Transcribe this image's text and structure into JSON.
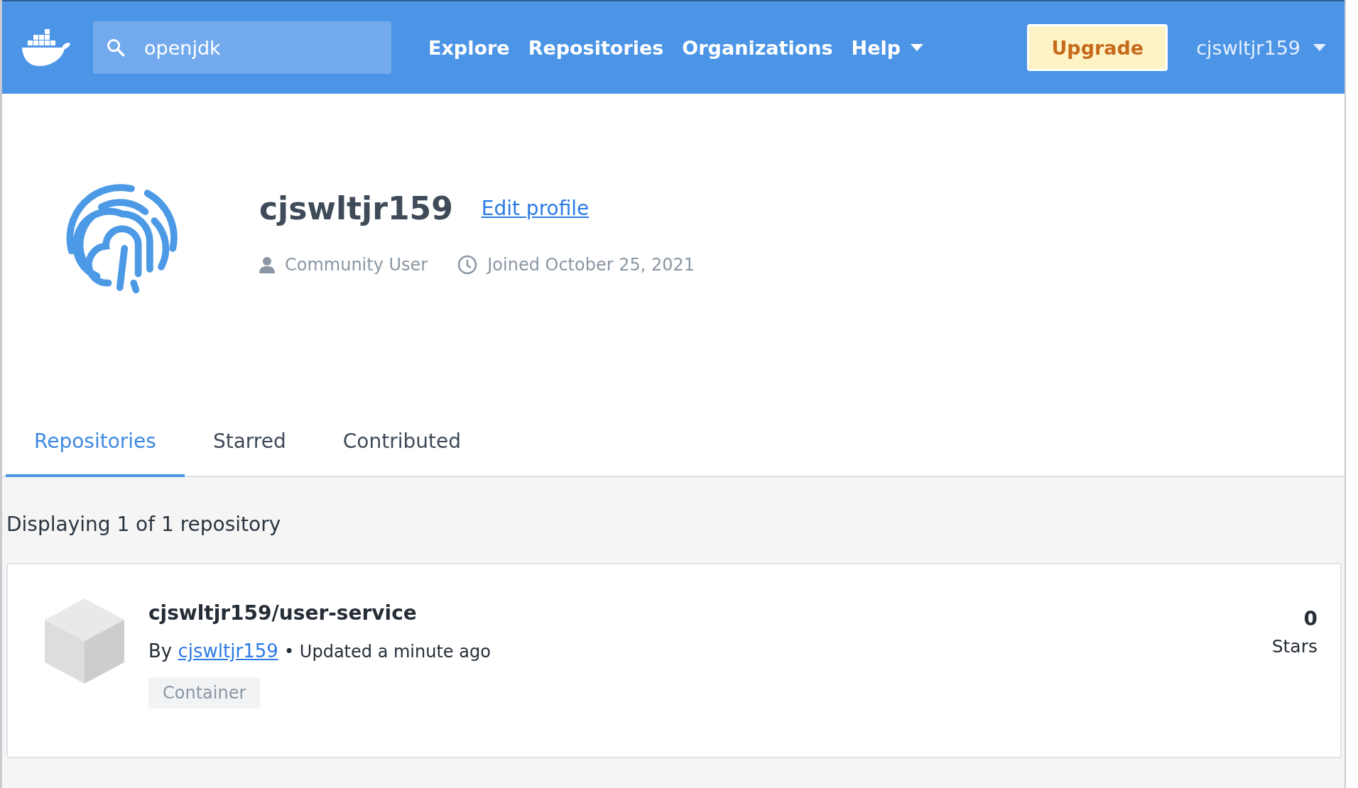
{
  "header": {
    "search": {
      "value": "openjdk"
    },
    "nav": [
      {
        "label": "Explore",
        "kind": "link"
      },
      {
        "label": "Repositories",
        "kind": "link"
      },
      {
        "label": "Organizations",
        "kind": "link"
      },
      {
        "label": "Help",
        "kind": "dropdown"
      }
    ],
    "upgrade": "Upgrade",
    "user": "cjswltjr159"
  },
  "profile": {
    "name": "cjswltjr159",
    "edit": "Edit profile",
    "role": "Community User",
    "joined": "Joined October 25, 2021"
  },
  "tabs": [
    {
      "label": "Repositories",
      "selected": true
    },
    {
      "label": "Starred",
      "selected": false
    },
    {
      "label": "Contributed",
      "selected": false
    }
  ],
  "summary": "Displaying 1 of 1 repository",
  "repositories": [
    {
      "name": "cjswltjr159/user-service",
      "by": "By",
      "owner": "cjswltjr159",
      "updated": "• Updated a minute ago",
      "tag": "Container",
      "stars": "0",
      "stars_label": "Stars"
    }
  ]
}
